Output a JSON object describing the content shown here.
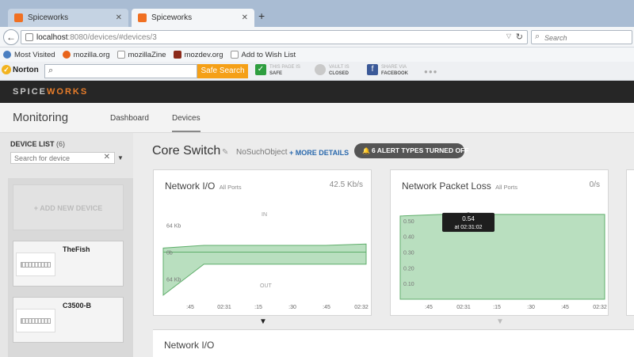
{
  "browser": {
    "tabs": [
      {
        "title": "Spiceworks",
        "active": false
      },
      {
        "title": "Spiceworks",
        "active": true
      }
    ],
    "new_tab": "+",
    "url_host": "localhost",
    "url_path": ":8080/devices/#devices/3",
    "search_placeholder": "Search",
    "bookmarks": [
      {
        "label": "Most Visited",
        "icon": "gear-icon",
        "color": "#4a7fc1"
      },
      {
        "label": "mozilla.org",
        "icon": "firefox-icon",
        "color": "#e8641b"
      },
      {
        "label": "mozillaZine",
        "icon": "page-icon",
        "color": "#ffffff"
      },
      {
        "label": "mozdev.org",
        "icon": "mozdev-icon",
        "color": "#8b2a1a"
      },
      {
        "label": "Add to Wish List",
        "icon": "page-icon",
        "color": "#ffffff"
      }
    ]
  },
  "norton": {
    "logo": "Norton",
    "safe_search": "Safe Search",
    "page_status_label": "THIS PAGE IS",
    "page_status_value": "SAFE",
    "vault_label": "VAULT IS",
    "vault_value": "CLOSED",
    "share_label": "SHARE VIA",
    "share_value": "FACEBOOK",
    "more": "●●●"
  },
  "app": {
    "logo_prefix": "SPICE",
    "logo_suffix": "WORKS",
    "section_title": "Monitoring",
    "tabs": [
      {
        "label": "Dashboard",
        "active": false
      },
      {
        "label": "Devices",
        "active": true
      }
    ]
  },
  "sidebar": {
    "title": "DEVICE LIST",
    "count": "(6)",
    "search_placeholder": "Search for device",
    "add_device": "+ ADD NEW DEVICE",
    "devices": [
      "TheFish",
      "C3500-B"
    ]
  },
  "device": {
    "name": "Core Switch",
    "snmp": "NoSuchObject",
    "more_details": "+ MORE DETAILS",
    "alert_pill": "6 ALERT TYPES TURNED OFF"
  },
  "cards": {
    "network_io": {
      "title": "Network I/O",
      "subtitle": "All Ports",
      "value": "42.5 Kb/s"
    },
    "packet_loss": {
      "title": "Network Packet Loss",
      "subtitle": "All Ports",
      "value": "0/s"
    },
    "network_io_bottom": {
      "title": "Network I/O"
    }
  },
  "chart_data": [
    {
      "type": "area",
      "title": "Network I/O",
      "x": [
        ":45",
        "02:31",
        ":15",
        ":30",
        ":45",
        "02:32"
      ],
      "ytick_labels": [
        "64 Kb",
        "0b",
        "64 Kb"
      ],
      "annotations": [
        "IN",
        "OUT"
      ],
      "series": [
        {
          "name": "IN",
          "values": [
            6,
            10,
            10,
            10,
            10,
            12
          ]
        },
        {
          "name": "OUT",
          "values": [
            -64,
            -18,
            -18,
            -18,
            -18,
            -18
          ]
        }
      ],
      "ylim": [
        -70,
        70
      ],
      "color": "#7fc48a"
    },
    {
      "type": "area",
      "title": "Network Packet Loss",
      "x": [
        ":45",
        "02:31",
        ":15",
        ":30",
        ":45",
        "02:32"
      ],
      "y_ticks": [
        "0.10",
        "0.20",
        "0.30",
        "0.40",
        "0.50"
      ],
      "values": [
        0.53,
        0.54,
        0.54,
        0.54,
        0.54,
        0.54
      ],
      "ylim": [
        0,
        0.6
      ],
      "tooltip": {
        "value": "0.54",
        "time": "at 02:31:02"
      },
      "color": "#7fc48a"
    }
  ]
}
